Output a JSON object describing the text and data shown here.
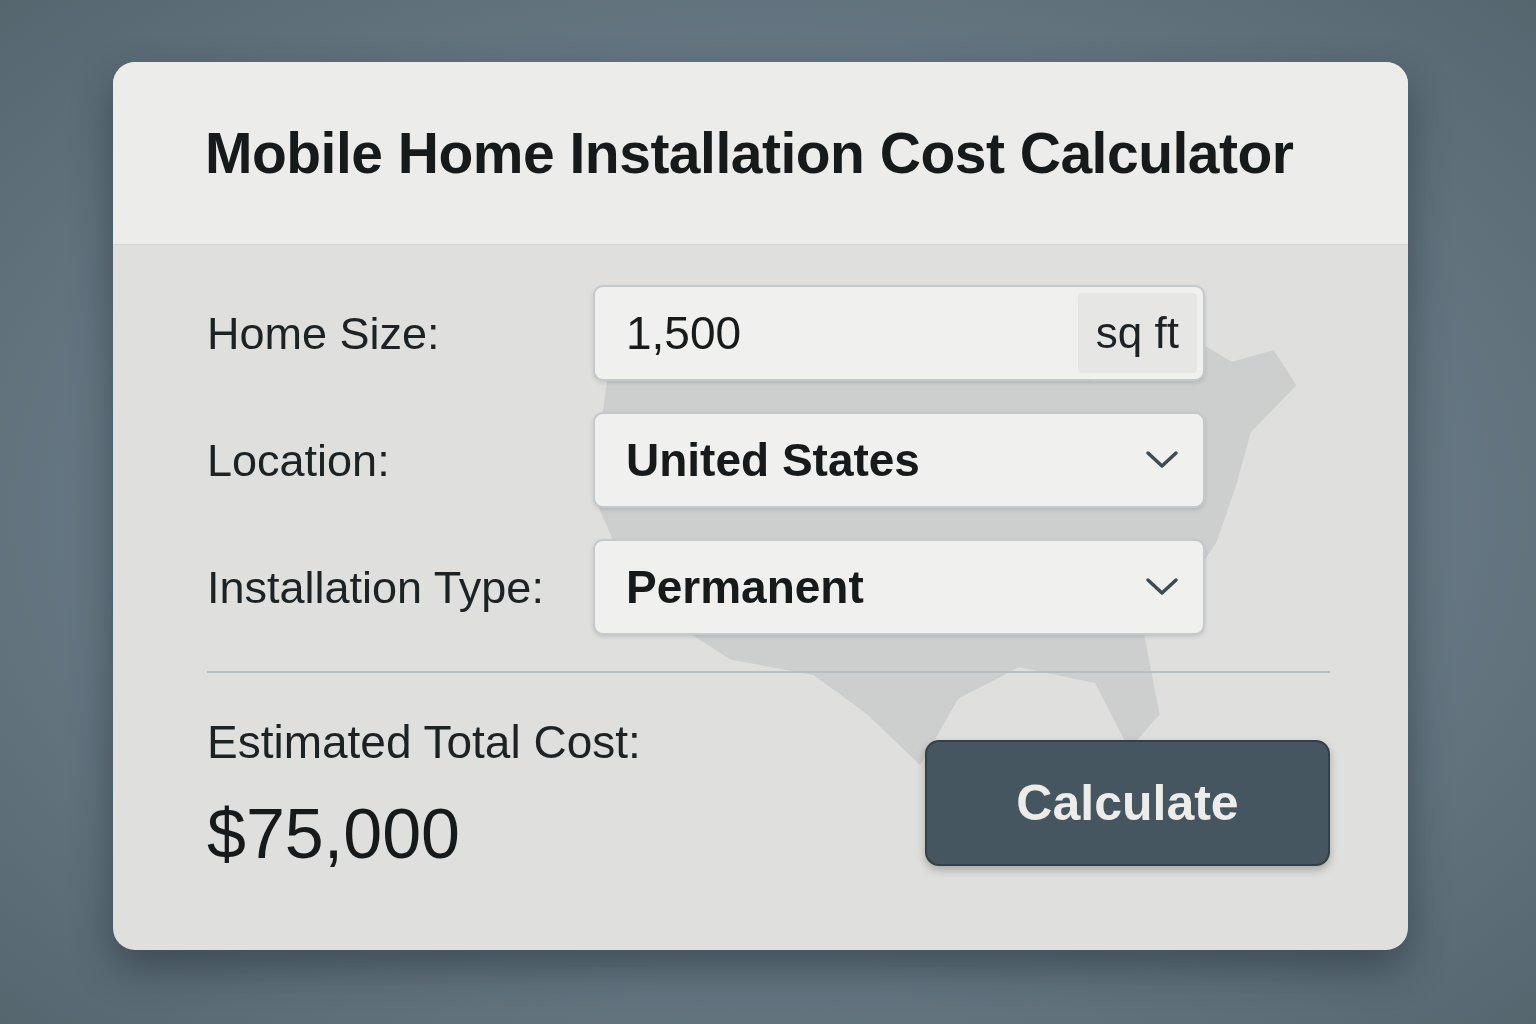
{
  "title": "Mobile Home Installation Cost Calculator",
  "fields": [
    {
      "kind": "input",
      "label": "Home Size:",
      "value": "1,500",
      "unit": "sq ft"
    },
    {
      "kind": "select",
      "label": "Location:",
      "value": "United States"
    },
    {
      "kind": "select",
      "label": "Installation Type:",
      "value": "Permanent"
    }
  ],
  "result": {
    "label": "Estimated Total Cost:",
    "value": "$75,000"
  },
  "button": "Calculate"
}
